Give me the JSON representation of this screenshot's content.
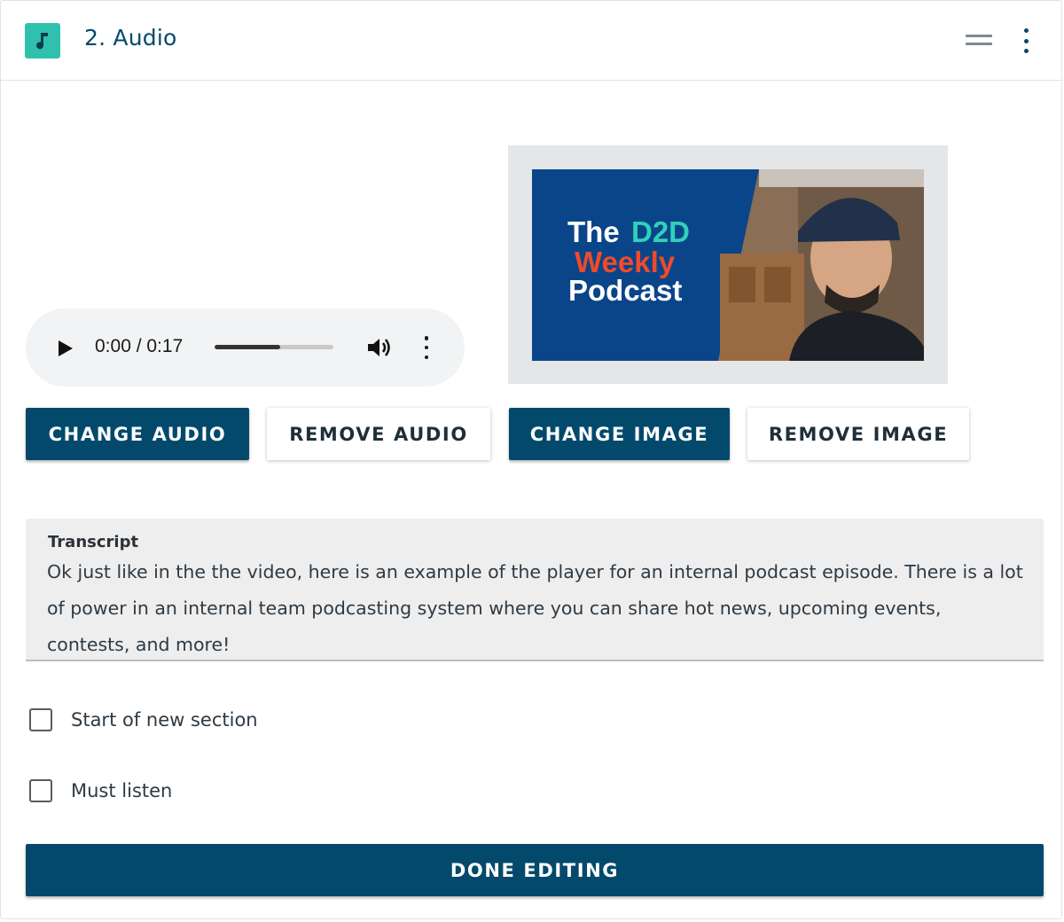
{
  "header": {
    "icon": "music-note-icon",
    "title": "2. Audio"
  },
  "player": {
    "time": "0:00 / 0:17",
    "progress_fraction": 0.55
  },
  "cover_image": {
    "line1_a": "The",
    "line1_b": "D2D",
    "line2": "Weekly",
    "line3": "Podcast",
    "colors": {
      "background": "#0a4589",
      "accent_teal": "#2fd1b8",
      "accent_red": "#f04a2a"
    }
  },
  "buttons": {
    "change_audio": "CHANGE AUDIO",
    "remove_audio": "REMOVE AUDIO",
    "change_image": "CHANGE IMAGE",
    "remove_image": "REMOVE IMAGE",
    "done_editing": "DONE EDITING"
  },
  "transcript": {
    "label": "Transcript",
    "text": "Ok just like in the the video, here is an example of the player for an internal podcast episode. There is a lot of power in an internal team podcasting system where you can share hot news, upcoming events, contests, and more!"
  },
  "options": {
    "start_new_section": "Start of new section",
    "must_listen": "Must listen"
  },
  "colors": {
    "primary": "#03496b",
    "header_icon_bg": "#2fc1ad"
  }
}
